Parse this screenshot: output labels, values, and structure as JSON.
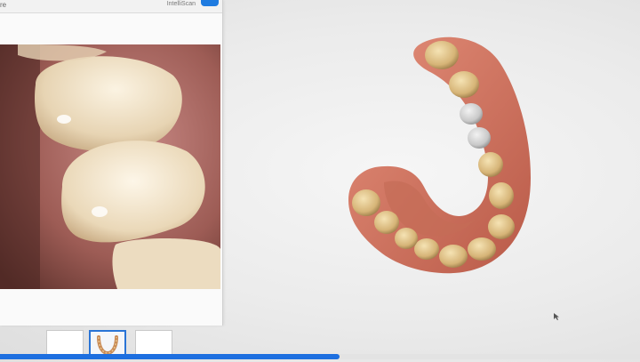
{
  "camera_panel": {
    "title": "re",
    "toggle_label": "IntelliScan",
    "toggle_on": true
  },
  "thumbnails": [
    {
      "name": "upper-jaw",
      "active": false
    },
    {
      "name": "lower-jaw",
      "active": true
    },
    {
      "name": "bite",
      "active": false
    }
  ],
  "scan_progress": 0.53,
  "colors": {
    "accent": "#1d6fe0",
    "gum": "#d77865",
    "tooth": "#dcc088"
  }
}
